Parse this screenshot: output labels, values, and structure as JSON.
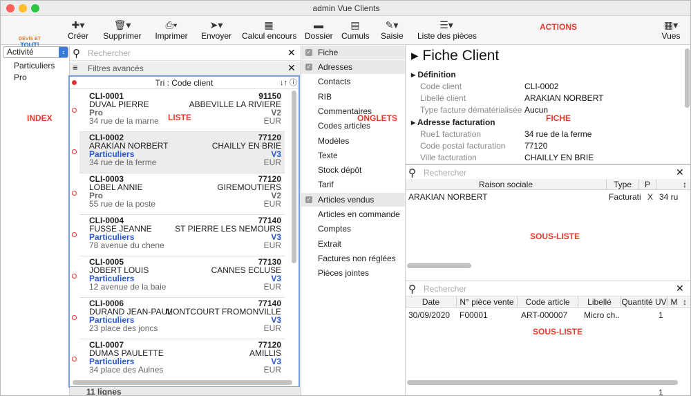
{
  "window": {
    "title": "admin Vue Clients"
  },
  "toolbar": {
    "creer": "Créer",
    "supprimer": "Supprimer",
    "imprimer": "Imprimer",
    "envoyer": "Envoyer",
    "calcul": "Calcul encours",
    "dossier": "Dossier",
    "cumuls": "Cumuls",
    "saisie": "Saisie",
    "pieces": "Liste des pièces",
    "vues": "Vues",
    "actions_label": "ACTIONS"
  },
  "logo": {
    "line1": "DEVIS ET",
    "line2": "TOUT!"
  },
  "annotations": {
    "index": "INDEX",
    "liste": "LISTE",
    "onglets": "ONGLETS",
    "fiche": "FICHE",
    "sous_liste_1": "SOUS-LISTE",
    "sous_liste_2": "SOUS-LISTE"
  },
  "index": {
    "selected": "Activité",
    "items": [
      "Particuliers",
      "Pro"
    ]
  },
  "search": {
    "placeholder": "Rechercher",
    "filters": "Filtres avancés"
  },
  "list": {
    "sort_label": "Tri : Code client",
    "status": "11 lignes",
    "rows": [
      {
        "code": "CLI-0001",
        "cp": "91150",
        "name": "DUVAL PIERRE",
        "city": "ABBEVILLE LA RIVIERE",
        "cat": "Pro",
        "ver": "V2",
        "addr": "34 rue de la marne",
        "cur": "EUR"
      },
      {
        "code": "CLI-0002",
        "cp": "77120",
        "name": "ARAKIAN NORBERT",
        "city": "CHAILLY EN BRIE",
        "cat": "Particuliers",
        "ver": "V3",
        "addr": "34 rue de la ferme",
        "cur": "EUR"
      },
      {
        "code": "CLI-0003",
        "cp": "77120",
        "name": "LOBEL ANNIE",
        "city": "GIREMOUTIERS",
        "cat": "Pro",
        "ver": "V2",
        "addr": "55 rue de la poste",
        "cur": "EUR"
      },
      {
        "code": "CLI-0004",
        "cp": "77140",
        "name": "FUSSE JEANNE",
        "city": "ST PIERRE LES NEMOURS",
        "cat": "Particuliers",
        "ver": "V3",
        "addr": "78 avenue du chene",
        "cur": "EUR"
      },
      {
        "code": "CLI-0005",
        "cp": "77130",
        "name": "JOBERT LOUIS",
        "city": "CANNES ECLUSE",
        "cat": "Particuliers",
        "ver": "V3",
        "addr": "12 avenue de la baie",
        "cur": "EUR"
      },
      {
        "code": "CLI-0006",
        "cp": "77140",
        "name": "DURAND JEAN-PAUL",
        "city": "MONTCOURT FROMONVILLE",
        "cat": "Particuliers",
        "ver": "V3",
        "addr": "23 place des joncs",
        "cur": "EUR"
      },
      {
        "code": "CLI-0007",
        "cp": "77120",
        "name": "DUMAS PAULETTE",
        "city": "AMILLIS",
        "cat": "Particuliers",
        "ver": "V3",
        "addr": "34 place des Aulnes",
        "cur": "EUR"
      }
    ]
  },
  "tabs": [
    "Fiche",
    "Adresses",
    "Contacts",
    "RIB",
    "Commentaires",
    "Codes articles",
    "Modèles",
    "Texte",
    "Stock dépôt",
    "Tarif",
    "Articles vendus",
    "Articles en commande",
    "Comptes",
    "Extrait",
    "Factures non réglées",
    "Pièces jointes"
  ],
  "fiche": {
    "title": "Fiche Client",
    "sec1": "Définition",
    "sec2": "Adresse facturation",
    "fields": [
      {
        "label": "Code client",
        "value": "CLI-0002"
      },
      {
        "label": "Libellé client",
        "value": "ARAKIAN NORBERT"
      },
      {
        "label": "Type facture dématérialisée",
        "value": "Aucun"
      },
      {
        "label": "Rue1 facturation",
        "value": "34 rue de la ferme"
      },
      {
        "label": "Code postal facturation",
        "value": "77120"
      },
      {
        "label": "Ville facturation",
        "value": "CHAILLY EN BRIE"
      }
    ]
  },
  "sub1": {
    "headers": [
      "Raison sociale",
      "Type",
      "P"
    ],
    "row": [
      "ARAKIAN NORBERT",
      "Facturati...",
      "X",
      "34 ru"
    ]
  },
  "sub2": {
    "headers": [
      "Date",
      "N° pièce vente",
      "Code article",
      "Libellé",
      "Quantité UV",
      "M"
    ],
    "row": [
      "30/09/2020",
      "F00001",
      "ART-000007",
      "Micro ch...",
      "1"
    ],
    "status": "1"
  }
}
